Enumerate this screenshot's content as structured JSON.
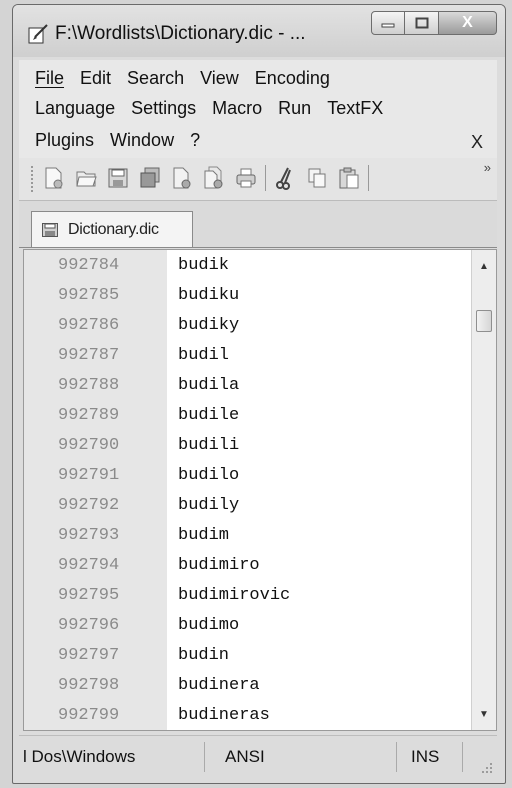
{
  "window": {
    "title": "F:\\Wordlists\\Dictionary.dic - ...",
    "close_glyph": "X"
  },
  "menu": {
    "row1": [
      "File",
      "Edit",
      "Search",
      "View",
      "Encoding"
    ],
    "row2": [
      "Language",
      "Settings",
      "Macro",
      "Run",
      "TextFX"
    ],
    "row3": [
      "Plugins",
      "Window",
      "?"
    ],
    "close_label": "X"
  },
  "toolbar": {
    "icons": [
      "new-file-icon",
      "open-file-icon",
      "save-icon",
      "save-all-icon",
      "close-icon",
      "close-all-icon",
      "print-icon",
      "cut-icon",
      "copy-icon",
      "paste-icon"
    ],
    "overflow": "»"
  },
  "tab": {
    "label": "Dictionary.dic"
  },
  "editor": {
    "lines": [
      {
        "num": "992784",
        "text": "budik"
      },
      {
        "num": "992785",
        "text": "budiku"
      },
      {
        "num": "992786",
        "text": "budiky"
      },
      {
        "num": "992787",
        "text": "budil"
      },
      {
        "num": "992788",
        "text": "budila"
      },
      {
        "num": "992789",
        "text": "budile"
      },
      {
        "num": "992790",
        "text": "budili"
      },
      {
        "num": "992791",
        "text": "budilo"
      },
      {
        "num": "992792",
        "text": "budily"
      },
      {
        "num": "992793",
        "text": "budim"
      },
      {
        "num": "992794",
        "text": "budimiro"
      },
      {
        "num": "992795",
        "text": "budimirovic"
      },
      {
        "num": "992796",
        "text": "budimo"
      },
      {
        "num": "992797",
        "text": "budin"
      },
      {
        "num": "992798",
        "text": "budinera"
      },
      {
        "num": "992799",
        "text": "budineras"
      }
    ]
  },
  "status": {
    "eol": "l Dos\\Windows",
    "encoding": "ANSI",
    "mode": "INS"
  }
}
